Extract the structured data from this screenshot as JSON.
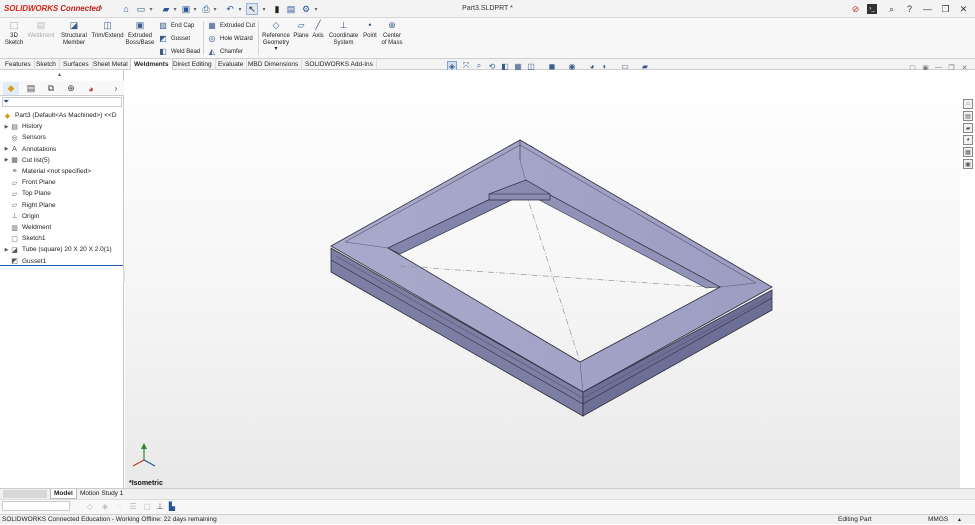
{
  "app": {
    "brand": "SOLIDWORKS",
    "brand_suffix": " Connected",
    "document_title": "Part3.SLDPRT *"
  },
  "ribbon": {
    "sketch_3d": "3D Sketch",
    "weldment": "Weldment",
    "structural_member": "Structural Member",
    "trim_extend": "Trim/Extend",
    "extruded_boss": "Extruded Boss/Base",
    "end_cap": "End Cap",
    "gusset": "Gusset",
    "weld_bead": "Weld Bead",
    "extruded_cut": "Extruded Cut",
    "hole_wizard": "Hole Wizard",
    "chamfer": "Chamfer",
    "reference_geometry": "Reference Geometry",
    "plane": "Plane",
    "axis": "Axis",
    "coordinate_system": "Coordinate System",
    "point": "Point",
    "center_of_mass": "Center of Mass"
  },
  "tabs": [
    "Features",
    "Sketch",
    "Surfaces",
    "Sheet Metal",
    "Weldments",
    "Direct Editing",
    "Evaluate",
    "MBD Dimensions",
    "SOLIDWORKS Add-Ins"
  ],
  "active_tab": "Weldments",
  "tree": [
    {
      "label": "Part3 (Default<As Machined>) <<D",
      "icon": "part-icon"
    },
    {
      "label": "History",
      "icon": "history-icon"
    },
    {
      "label": "Sensors",
      "icon": "sensor-icon"
    },
    {
      "label": "Annotations",
      "icon": "annotation-icon"
    },
    {
      "label": "Cut list(5)",
      "icon": "cutlist-icon"
    },
    {
      "label": "Material <not specified>",
      "icon": "material-icon"
    },
    {
      "label": "Front Plane",
      "icon": "plane-icon"
    },
    {
      "label": "Top Plane",
      "icon": "plane-icon"
    },
    {
      "label": "Right Plane",
      "icon": "plane-icon"
    },
    {
      "label": "Origin",
      "icon": "origin-icon"
    },
    {
      "label": "Weldment",
      "icon": "weldment-icon"
    },
    {
      "label": "Sketch1",
      "icon": "sketch-icon"
    },
    {
      "label": "Tube (square) 20 X 20 X 2.0(1)",
      "icon": "structural-member-icon"
    },
    {
      "label": "Gusset1",
      "icon": "gusset-icon"
    }
  ],
  "viewport": {
    "view_name": "*Isometric"
  },
  "bottom_tabs": [
    "Model",
    "Motion Study 1"
  ],
  "active_bottom_tab": "Model",
  "status": {
    "left": "SOLIDWORKS Connected Education - Working Offline: 22 days remaining",
    "mode": "Editing Part",
    "units": "MMGS"
  }
}
